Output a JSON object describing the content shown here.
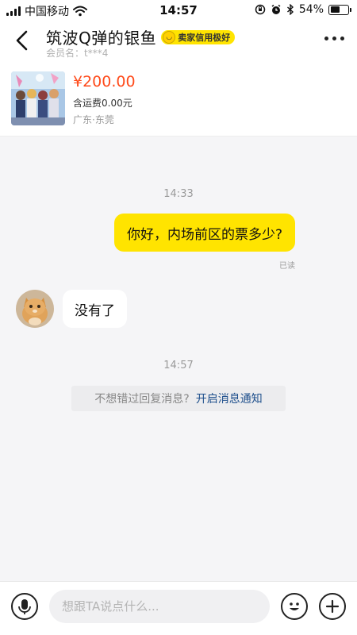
{
  "status_bar": {
    "carrier": "中国移动",
    "time": "14:57",
    "battery_percent": "54%",
    "battery_level": 0.54
  },
  "header": {
    "title": "筑波Q弹的银鱼",
    "credit_badge": "卖家信用极好",
    "member_name": "会员名：t***4"
  },
  "product": {
    "price": "¥200.00",
    "shipping": "含运费0.00元",
    "location": "广东·东莞"
  },
  "chat": {
    "timestamp_1": "14:33",
    "outgoing_message": "你好，内场前区的票多少?",
    "read_status": "已读",
    "incoming_message": "没有了",
    "timestamp_2": "14:57",
    "notify_text": "不想错过回复消息?",
    "notify_link": "开启消息通知"
  },
  "input": {
    "placeholder": "想跟TA说点什么..."
  },
  "icons": {
    "back": "chevron-left-icon",
    "more": "more-horizontal-icon",
    "mic": "microphone-icon",
    "emoji": "smiley-icon",
    "plus": "plus-icon"
  },
  "colors": {
    "accent_yellow": "#ffe400",
    "price_red": "#ff4a1a",
    "link_blue": "#1e4f8c"
  }
}
